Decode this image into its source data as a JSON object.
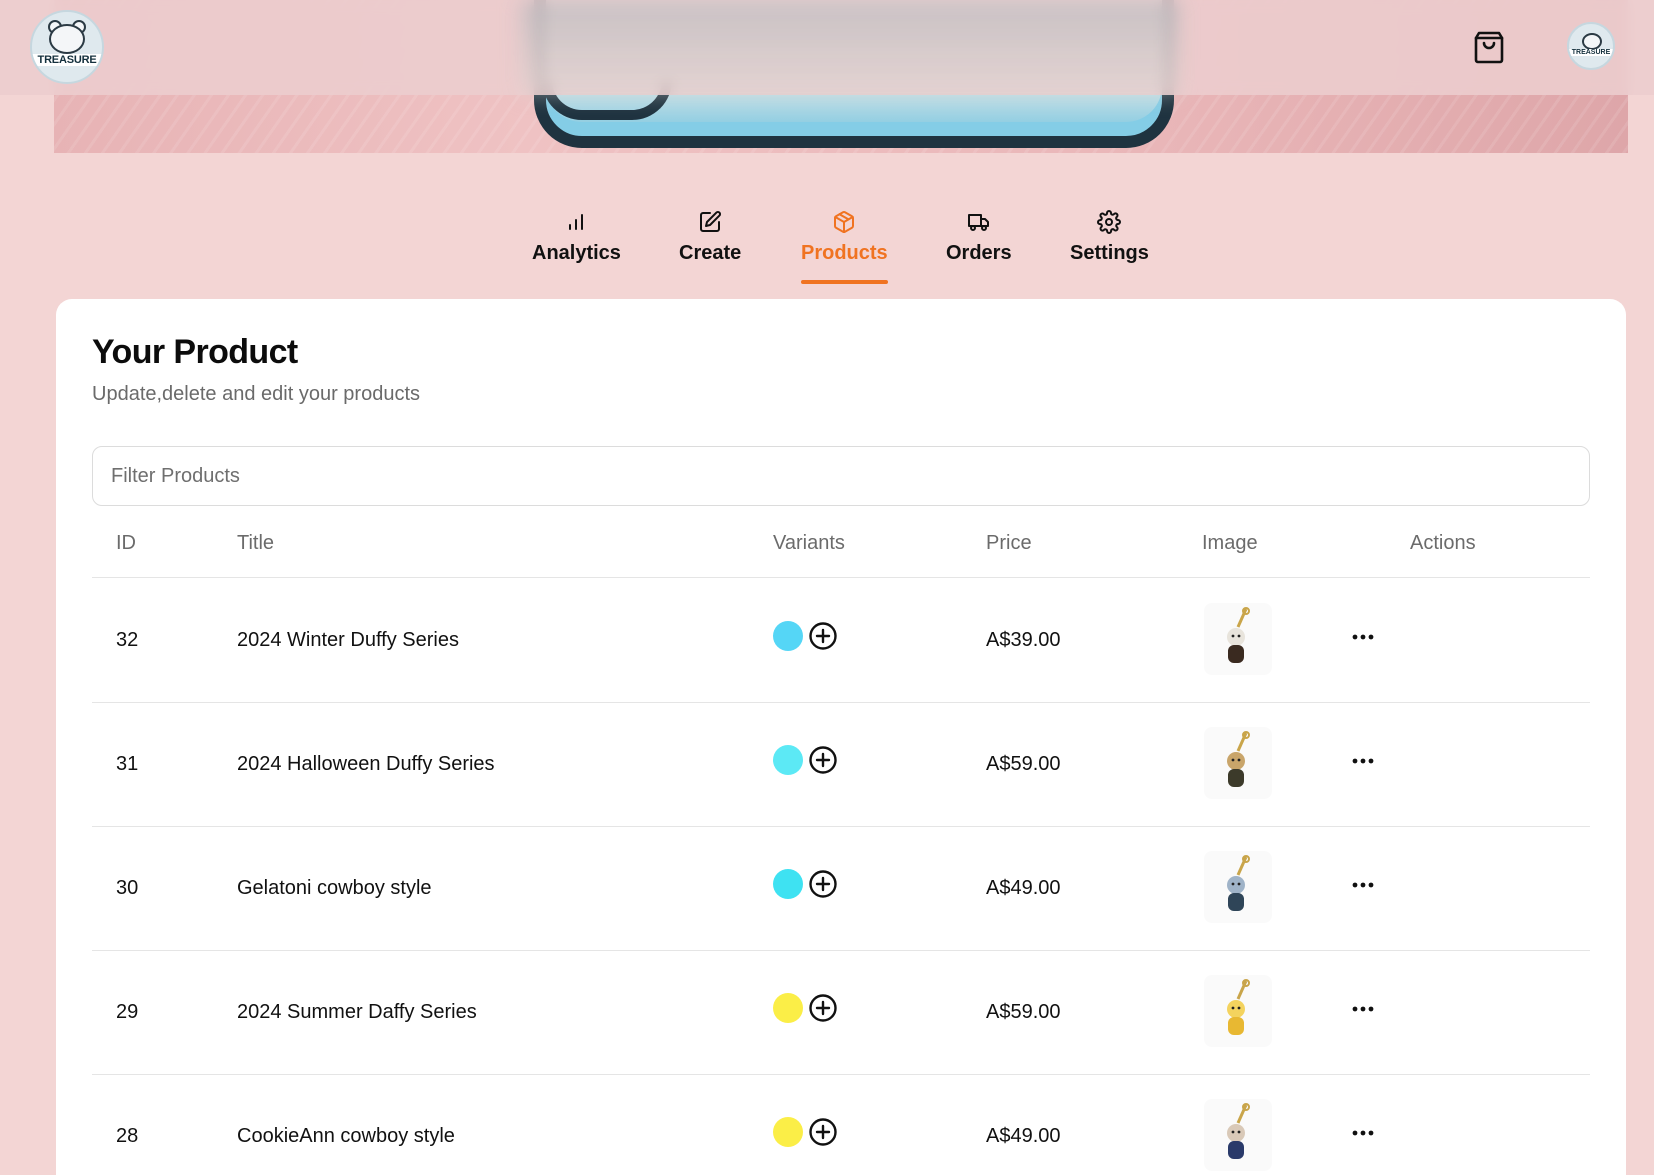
{
  "header": {
    "brand_logo_text": "TREASURE",
    "cart_icon": "shopping-bag-icon",
    "avatar_text": "TREASURE"
  },
  "tabs": [
    {
      "label": "Analytics",
      "icon": "bar-chart-icon",
      "active": false
    },
    {
      "label": "Create",
      "icon": "edit-icon",
      "active": false
    },
    {
      "label": "Products",
      "icon": "package-icon",
      "active": true
    },
    {
      "label": "Orders",
      "icon": "truck-icon",
      "active": false
    },
    {
      "label": "Settings",
      "icon": "gear-icon",
      "active": false
    }
  ],
  "colors": {
    "accent": "#f07321",
    "background": "#f3d5d4"
  },
  "card": {
    "title": "Your Product",
    "subtitle": "Update,delete and edit your products",
    "filter_placeholder": "Filter Products"
  },
  "table": {
    "columns": [
      "ID",
      "Title",
      "Variants",
      "Price",
      "Image",
      "Actions"
    ],
    "rows": [
      {
        "id": "32",
        "title": "2024 Winter Duffy Series",
        "variant_color": "#55d6f6",
        "price": "A$39.00",
        "image": "winter-duffy-thumbnail"
      },
      {
        "id": "31",
        "title": "2024 Halloween Duffy Series",
        "variant_color": "#5ce9f5",
        "price": "A$59.00",
        "image": "halloween-duffy-thumbnail"
      },
      {
        "id": "30",
        "title": "Gelatoni cowboy style",
        "variant_color": "#3ee2f2",
        "price": "A$49.00",
        "image": "gelatoni-cowboy-thumbnail"
      },
      {
        "id": "29",
        "title": "2024 Summer Daffy Series",
        "variant_color": "#fbee47",
        "price": "A$59.00",
        "image": "summer-daffy-thumbnail"
      },
      {
        "id": "28",
        "title": "CookieAnn cowboy style",
        "variant_color": "#fbee47",
        "price": "A$49.00",
        "image": "cookieann-cowboy-thumbnail"
      }
    ]
  }
}
